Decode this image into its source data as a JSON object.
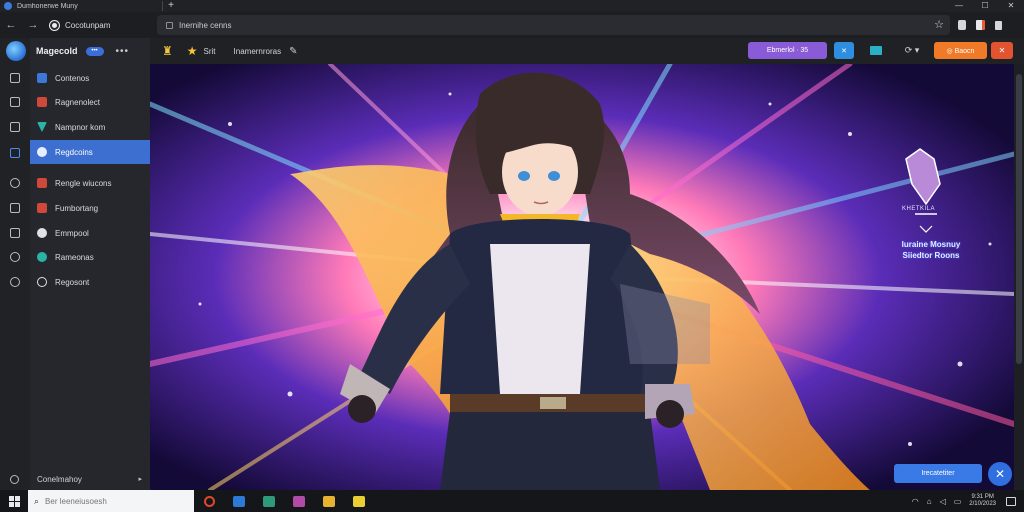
{
  "window": {
    "title": "Dumhonerwe Muny",
    "new_tab": "+",
    "controls": {
      "minimize": "—",
      "maximize": "☐",
      "close": "✕"
    }
  },
  "nav": {
    "back": "←",
    "forward": "→",
    "page_chip": "Cocotunpam",
    "address_value": "Inernihe cenns"
  },
  "sidebar": {
    "brand": "Magecold",
    "badge": "•••",
    "more": "•••",
    "items": [
      {
        "label": "Contenos",
        "icon_color": "#3b78d8"
      },
      {
        "label": "Ragnenolect",
        "icon_color": "#d0483a"
      },
      {
        "label": "Nampnor kom",
        "icon_color": "#2ab3a6"
      },
      {
        "label": "Regdcoins",
        "icon_color": "#3b78d8",
        "active": true
      },
      {
        "label": "Rengle wiucons",
        "icon_color": "#d0483a"
      },
      {
        "label": "Fumbortang",
        "icon_color": "#d0483a"
      },
      {
        "label": "Emmpool",
        "icon_color": "#dfe2e8"
      },
      {
        "label": "Rameonas",
        "icon_color": "#2ab3a6"
      },
      {
        "label": "Regosont",
        "icon_color": "#dfe2e8"
      }
    ],
    "footer": {
      "label": "Conelmahoy",
      "arrow": "▸"
    }
  },
  "toolbar": {
    "label_short": "Srit",
    "title": "Inamernroras",
    "pen": "✎",
    "purple_button": "Ebmerlol ∙ 35",
    "cyan_button": "✕",
    "ghost_button": "⟳ ▾",
    "orange_button": "◎ Baocn",
    "red_button": "✕"
  },
  "hero": {
    "logo_text": "KHETKILA",
    "caption_line1": "Iuraine Mosnuy",
    "caption_line2": "Siiedtor Roons",
    "cta": "Irecatetiter",
    "fab": "✕"
  },
  "taskbar": {
    "search_placeholder": "Ber leeneiusoesh",
    "apps": [
      {
        "name": "circle-app",
        "color": "#e0482c"
      },
      {
        "name": "files-app",
        "color": "#2c7ad6"
      },
      {
        "name": "store-app",
        "color": "#2f9a77"
      },
      {
        "name": "media-app",
        "color": "#b24ba6"
      },
      {
        "name": "folder-app",
        "color": "#e7b22f"
      },
      {
        "name": "notes-app",
        "color": "#e9cf33"
      }
    ],
    "clock_time": "9:31 PM",
    "clock_date": "2/10/2023"
  },
  "colors": {
    "accent": "#3d6fd0",
    "sidebar_bg": "#25272c",
    "toolbar_bg": "#1f2125"
  }
}
